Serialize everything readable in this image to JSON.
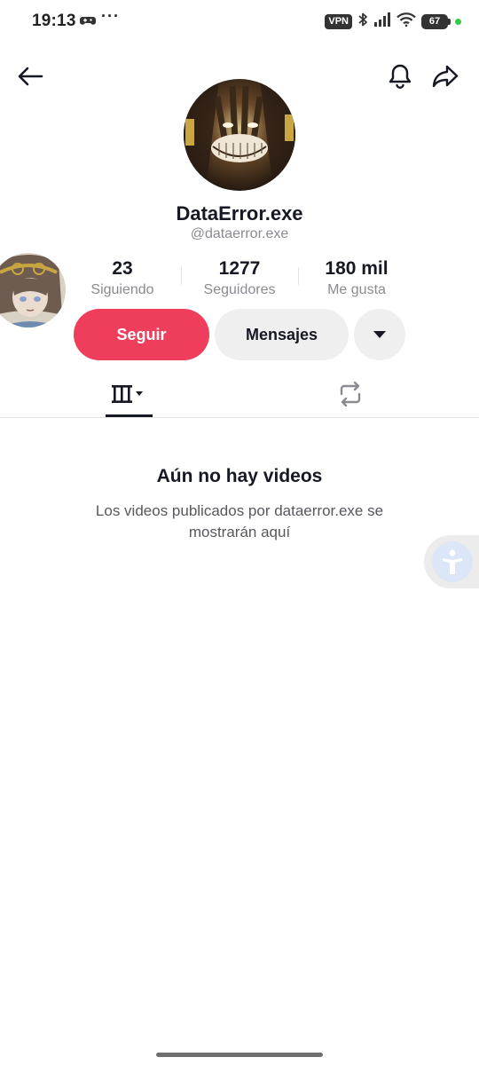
{
  "status_bar": {
    "time": "19:13",
    "dots": "···",
    "vpn": "VPN",
    "battery": "67"
  },
  "profile": {
    "name": "DataError.exe",
    "handle": "@dataerror.exe"
  },
  "stats": {
    "following": {
      "value": "23",
      "label": "Siguiendo"
    },
    "followers": {
      "value": "1277",
      "label": "Seguidores"
    },
    "likes": {
      "value": "180 mil",
      "label": "Me gusta"
    }
  },
  "actions": {
    "follow_label": "Seguir",
    "message_label": "Mensajes"
  },
  "empty_state": {
    "title": "Aún no hay videos",
    "description": "Los videos publicados por dataerror.exe se mostrarán aquí"
  },
  "colors": {
    "accent": "#ee3e5b",
    "secondary_button": "#efefef",
    "text_primary": "#161823",
    "text_secondary": "#8a8b91"
  },
  "icons": [
    "back-arrow-icon",
    "bell-icon",
    "share-icon",
    "chevron-down-icon",
    "grid-icon",
    "repost-icon",
    "accessibility-icon"
  ]
}
